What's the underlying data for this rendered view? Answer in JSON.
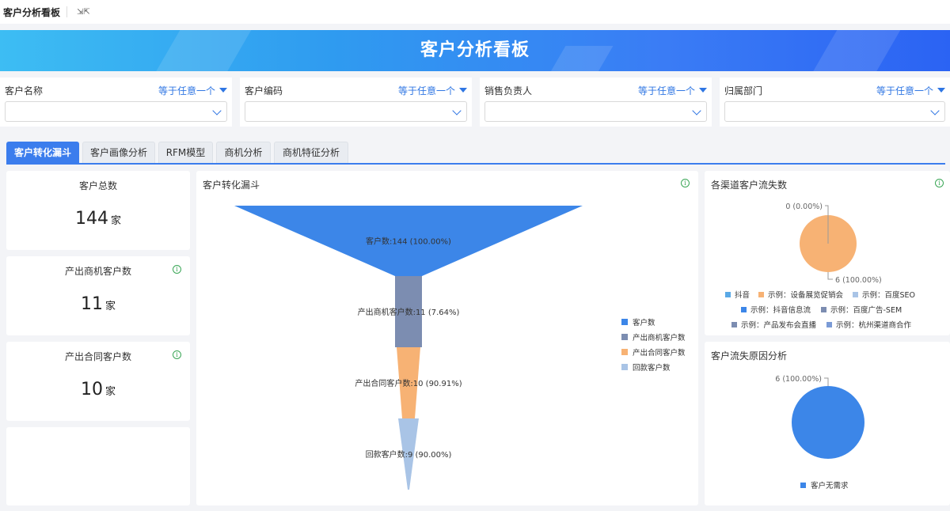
{
  "app": {
    "title": "客户分析看板"
  },
  "banner": {
    "title": "客户分析看板"
  },
  "filters": [
    {
      "label": "客户名称",
      "operator": "等于任意一个",
      "value": ""
    },
    {
      "label": "客户编码",
      "operator": "等于任意一个",
      "value": ""
    },
    {
      "label": "销售负责人",
      "operator": "等于任意一个",
      "value": ""
    },
    {
      "label": "归属部门",
      "operator": "等于任意一个",
      "value": ""
    }
  ],
  "tabs": [
    {
      "label": "客户转化漏斗",
      "active": true
    },
    {
      "label": "客户画像分析",
      "active": false
    },
    {
      "label": "RFM模型",
      "active": false
    },
    {
      "label": "商机分析",
      "active": false
    },
    {
      "label": "商机特征分析",
      "active": false
    }
  ],
  "kpis": [
    {
      "title": "客户总数",
      "value": "144",
      "unit": "家"
    },
    {
      "title": "产出商机客户数",
      "value": "11",
      "unit": "家"
    },
    {
      "title": "产出合同客户数",
      "value": "10",
      "unit": "家"
    }
  ],
  "funnel_card": {
    "title": "客户转化漏斗"
  },
  "channel_card": {
    "title": "各渠道客户流失数"
  },
  "reason_card": {
    "title": "客户流失原因分析"
  },
  "colors": {
    "accent": "#3b7ded",
    "info": "#3aa656"
  },
  "chart_data": [
    {
      "type": "funnel",
      "title": "客户转化漏斗",
      "stages": [
        {
          "name": "客户数",
          "value": 144,
          "label": "客户数:144 (100.00%)",
          "color": "#3c86e8"
        },
        {
          "name": "产出商机客户数",
          "value": 11,
          "label": "产出商机客户数:11 (7.64%)",
          "color": "#7c8db1"
        },
        {
          "name": "产出合同客户数",
          "value": 10,
          "label": "产出合同客户数:10 (90.91%)",
          "color": "#f7b274"
        },
        {
          "name": "回款客户数",
          "value": 9,
          "label": "回款客户数:9 (90.00%)",
          "color": "#a9c4e6"
        }
      ],
      "legend": [
        "客户数",
        "产出商机客户数",
        "产出合同客户数",
        "回款客户数"
      ]
    },
    {
      "type": "pie",
      "title": "各渠道客户流失数",
      "slices": [
        {
          "name": "示例：设备展览促销会",
          "value": 6,
          "label": "6 (100.00%)",
          "color": "#f7b274"
        },
        {
          "name": "抖音",
          "value": 0,
          "label": "0 (0.00%)",
          "color": "#5aa9e6"
        }
      ],
      "legend": [
        {
          "name": "抖音",
          "color": "#5aa9e6"
        },
        {
          "name": "示例：设备展览促销会",
          "color": "#f7b274"
        },
        {
          "name": "示例：百度SEO",
          "color": "#a9c4e6"
        },
        {
          "name": "示例：抖音信息流",
          "color": "#3c86e8"
        },
        {
          "name": "示例：百度广告-SEM",
          "color": "#7c8db1"
        },
        {
          "name": "示例：产品发布会直播",
          "color": "#7c8db1"
        },
        {
          "name": "示例：杭州渠道商合作",
          "color": "#7b9bd6"
        }
      ]
    },
    {
      "type": "pie",
      "title": "客户流失原因分析",
      "slices": [
        {
          "name": "客户无需求",
          "value": 6,
          "label": "6 (100.00%)",
          "color": "#3c86e8"
        }
      ],
      "legend": [
        {
          "name": "客户无需求",
          "color": "#3c86e8"
        }
      ]
    }
  ]
}
